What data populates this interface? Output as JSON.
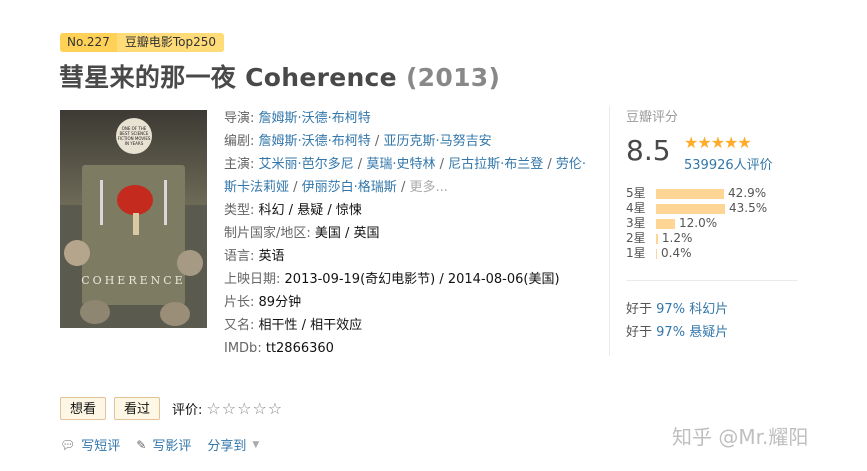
{
  "badge": {
    "rank": "No.227",
    "list": "豆瓣电影Top250"
  },
  "title": {
    "main": "彗星来的那一夜 Coherence",
    "year": "(2013)"
  },
  "poster": {
    "tagline": "ONE OF THE BEST SCIENCE FICTION MOVIES IN YEARS",
    "name": "COHERENCE"
  },
  "info": {
    "director_label": "导演:",
    "director": "詹姆斯·沃德·布柯特",
    "writer_label": "编剧:",
    "writers": [
      "詹姆斯·沃德·布柯特",
      "亚历克斯·马努吉安"
    ],
    "cast_label": "主演:",
    "cast": [
      "艾米丽·芭尔多尼",
      "莫瑞·史特林",
      "尼古拉斯·布兰登",
      "劳伦·斯卡法莉娅",
      "伊丽莎白·格瑞斯"
    ],
    "cast_more": "更多...",
    "genre_label": "类型:",
    "genres": [
      "科幻",
      "悬疑",
      "惊悚"
    ],
    "region_label": "制片国家/地区:",
    "region": "美国 / 英国",
    "language_label": "语言:",
    "language": "英语",
    "release_label": "上映日期:",
    "release": "2013-09-19(奇幻电影节) / 2014-08-06(美国)",
    "runtime_label": "片长:",
    "runtime": "89分钟",
    "aka_label": "又名:",
    "aka": "相干性 / 相干效应",
    "imdb_label": "IMDb:",
    "imdb": "tt2866360",
    "separator": " / "
  },
  "rating": {
    "label": "豆瓣评分",
    "score": "8.5",
    "stars": 4.5,
    "stars_display": "★★★★★",
    "count": "539926人评价",
    "distribution": [
      {
        "label": "5星",
        "percent": 42.9,
        "text": "42.9%"
      },
      {
        "label": "4星",
        "percent": 43.5,
        "text": "43.5%"
      },
      {
        "label": "3星",
        "percent": 12.0,
        "text": "12.0%"
      },
      {
        "label": "2星",
        "percent": 1.2,
        "text": "1.2%"
      },
      {
        "label": "1星",
        "percent": 0.4,
        "text": "0.4%"
      }
    ],
    "better_than": [
      {
        "prefix": "好于",
        "percent": "97%",
        "genre": "科幻片"
      },
      {
        "prefix": "好于",
        "percent": "97%",
        "genre": "悬疑片"
      }
    ]
  },
  "actions": {
    "want": "想看",
    "watched": "看过",
    "rate_label": "评价:",
    "rate_stars": "☆☆☆☆☆"
  },
  "footer": {
    "short_review": "写短评",
    "review": "写影评",
    "share": "分享到"
  },
  "watermark": "知乎 @Mr.耀阳",
  "colors": {
    "link": "#3377aa",
    "star": "#ffac2d",
    "bar": "#ffd596",
    "badge": "#ffd257"
  }
}
